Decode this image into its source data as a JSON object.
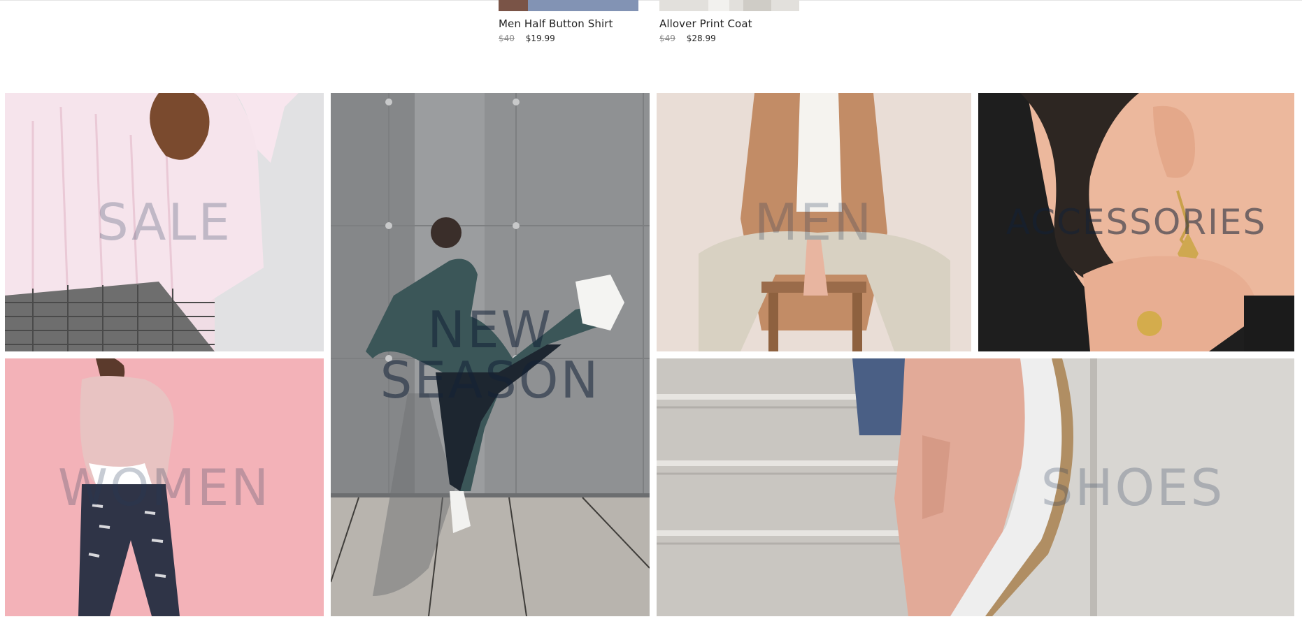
{
  "products": [
    {
      "name": "Men Half Button Shirt",
      "old_price": "$40",
      "price": "$19.99"
    },
    {
      "name": "Allover Print Coat",
      "old_price": "$49",
      "price": "$28.99"
    }
  ],
  "categories": {
    "sale": "SALE",
    "new_season": "NEW\nSEASON",
    "men": "MEN",
    "accessories": "ACCESSORIES",
    "women": "WOMEN",
    "shoes": "SHOES"
  },
  "colors": {
    "label": "#263a58",
    "sale_bg": "#f1dbe4",
    "women_bg": "#f3b0b6",
    "new_season_bg": "#8d8f91",
    "men_bg": "#e8dcd6",
    "accessories_bg": "#1f1f1f",
    "shoes_bg": "#d5d2cc"
  }
}
